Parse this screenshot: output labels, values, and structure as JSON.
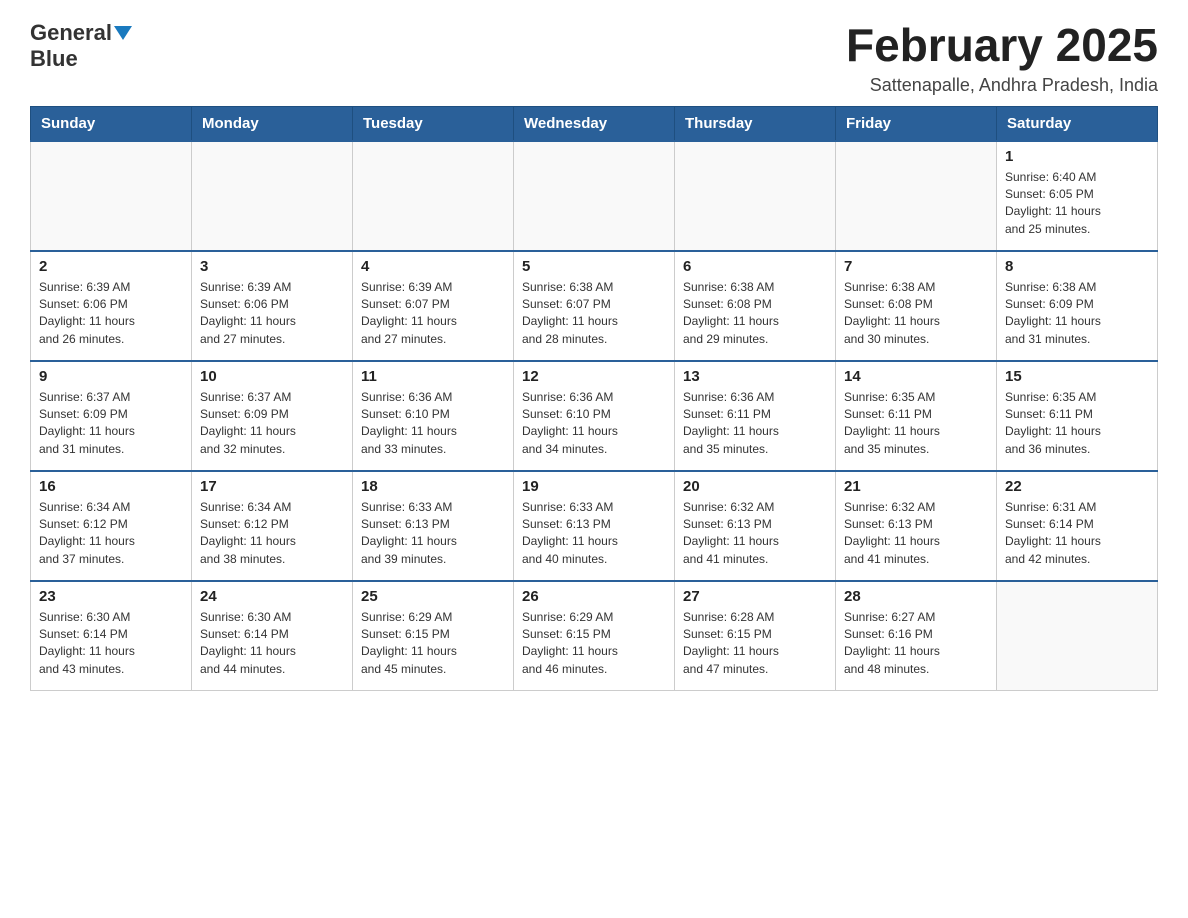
{
  "header": {
    "logo_general": "General",
    "logo_blue": "Blue",
    "month_title": "February 2025",
    "location": "Sattenapalle, Andhra Pradesh, India"
  },
  "weekdays": [
    "Sunday",
    "Monday",
    "Tuesday",
    "Wednesday",
    "Thursday",
    "Friday",
    "Saturday"
  ],
  "weeks": [
    [
      {
        "day": "",
        "info": ""
      },
      {
        "day": "",
        "info": ""
      },
      {
        "day": "",
        "info": ""
      },
      {
        "day": "",
        "info": ""
      },
      {
        "day": "",
        "info": ""
      },
      {
        "day": "",
        "info": ""
      },
      {
        "day": "1",
        "info": "Sunrise: 6:40 AM\nSunset: 6:05 PM\nDaylight: 11 hours\nand 25 minutes."
      }
    ],
    [
      {
        "day": "2",
        "info": "Sunrise: 6:39 AM\nSunset: 6:06 PM\nDaylight: 11 hours\nand 26 minutes."
      },
      {
        "day": "3",
        "info": "Sunrise: 6:39 AM\nSunset: 6:06 PM\nDaylight: 11 hours\nand 27 minutes."
      },
      {
        "day": "4",
        "info": "Sunrise: 6:39 AM\nSunset: 6:07 PM\nDaylight: 11 hours\nand 27 minutes."
      },
      {
        "day": "5",
        "info": "Sunrise: 6:38 AM\nSunset: 6:07 PM\nDaylight: 11 hours\nand 28 minutes."
      },
      {
        "day": "6",
        "info": "Sunrise: 6:38 AM\nSunset: 6:08 PM\nDaylight: 11 hours\nand 29 minutes."
      },
      {
        "day": "7",
        "info": "Sunrise: 6:38 AM\nSunset: 6:08 PM\nDaylight: 11 hours\nand 30 minutes."
      },
      {
        "day": "8",
        "info": "Sunrise: 6:38 AM\nSunset: 6:09 PM\nDaylight: 11 hours\nand 31 minutes."
      }
    ],
    [
      {
        "day": "9",
        "info": "Sunrise: 6:37 AM\nSunset: 6:09 PM\nDaylight: 11 hours\nand 31 minutes."
      },
      {
        "day": "10",
        "info": "Sunrise: 6:37 AM\nSunset: 6:09 PM\nDaylight: 11 hours\nand 32 minutes."
      },
      {
        "day": "11",
        "info": "Sunrise: 6:36 AM\nSunset: 6:10 PM\nDaylight: 11 hours\nand 33 minutes."
      },
      {
        "day": "12",
        "info": "Sunrise: 6:36 AM\nSunset: 6:10 PM\nDaylight: 11 hours\nand 34 minutes."
      },
      {
        "day": "13",
        "info": "Sunrise: 6:36 AM\nSunset: 6:11 PM\nDaylight: 11 hours\nand 35 minutes."
      },
      {
        "day": "14",
        "info": "Sunrise: 6:35 AM\nSunset: 6:11 PM\nDaylight: 11 hours\nand 35 minutes."
      },
      {
        "day": "15",
        "info": "Sunrise: 6:35 AM\nSunset: 6:11 PM\nDaylight: 11 hours\nand 36 minutes."
      }
    ],
    [
      {
        "day": "16",
        "info": "Sunrise: 6:34 AM\nSunset: 6:12 PM\nDaylight: 11 hours\nand 37 minutes."
      },
      {
        "day": "17",
        "info": "Sunrise: 6:34 AM\nSunset: 6:12 PM\nDaylight: 11 hours\nand 38 minutes."
      },
      {
        "day": "18",
        "info": "Sunrise: 6:33 AM\nSunset: 6:13 PM\nDaylight: 11 hours\nand 39 minutes."
      },
      {
        "day": "19",
        "info": "Sunrise: 6:33 AM\nSunset: 6:13 PM\nDaylight: 11 hours\nand 40 minutes."
      },
      {
        "day": "20",
        "info": "Sunrise: 6:32 AM\nSunset: 6:13 PM\nDaylight: 11 hours\nand 41 minutes."
      },
      {
        "day": "21",
        "info": "Sunrise: 6:32 AM\nSunset: 6:13 PM\nDaylight: 11 hours\nand 41 minutes."
      },
      {
        "day": "22",
        "info": "Sunrise: 6:31 AM\nSunset: 6:14 PM\nDaylight: 11 hours\nand 42 minutes."
      }
    ],
    [
      {
        "day": "23",
        "info": "Sunrise: 6:30 AM\nSunset: 6:14 PM\nDaylight: 11 hours\nand 43 minutes."
      },
      {
        "day": "24",
        "info": "Sunrise: 6:30 AM\nSunset: 6:14 PM\nDaylight: 11 hours\nand 44 minutes."
      },
      {
        "day": "25",
        "info": "Sunrise: 6:29 AM\nSunset: 6:15 PM\nDaylight: 11 hours\nand 45 minutes."
      },
      {
        "day": "26",
        "info": "Sunrise: 6:29 AM\nSunset: 6:15 PM\nDaylight: 11 hours\nand 46 minutes."
      },
      {
        "day": "27",
        "info": "Sunrise: 6:28 AM\nSunset: 6:15 PM\nDaylight: 11 hours\nand 47 minutes."
      },
      {
        "day": "28",
        "info": "Sunrise: 6:27 AM\nSunset: 6:16 PM\nDaylight: 11 hours\nand 48 minutes."
      },
      {
        "day": "",
        "info": ""
      }
    ]
  ]
}
